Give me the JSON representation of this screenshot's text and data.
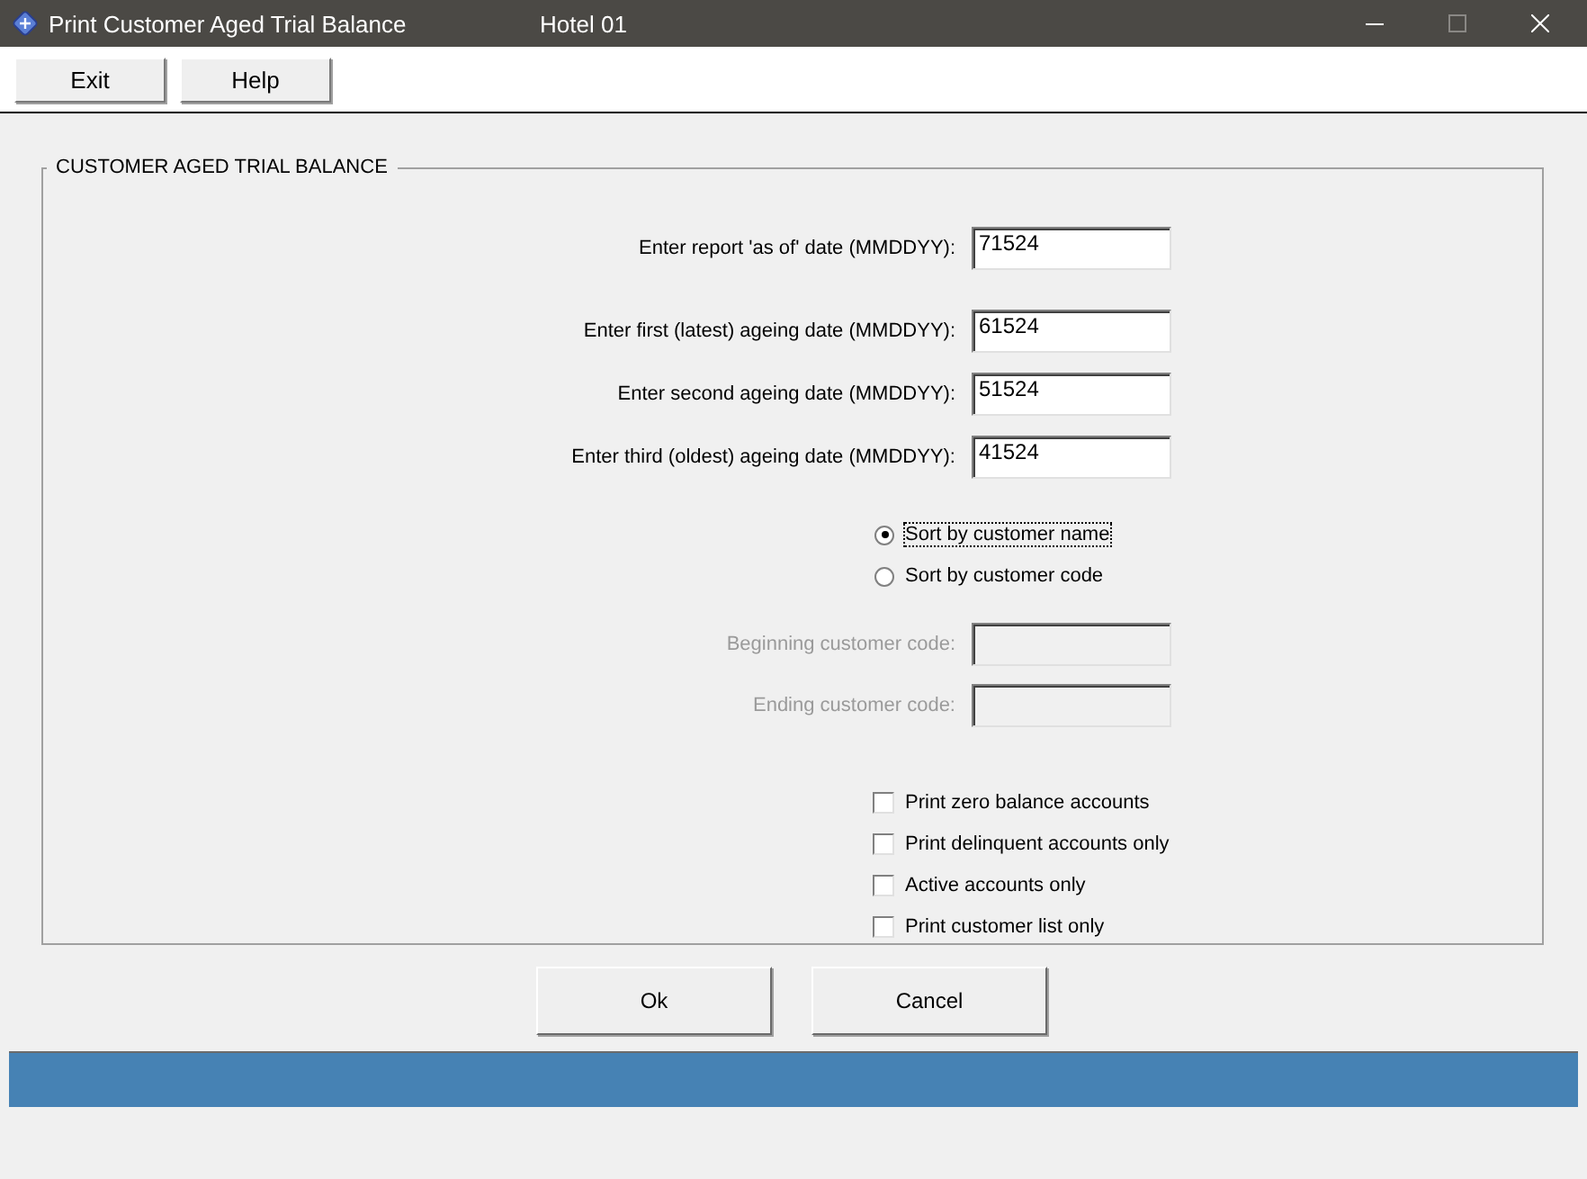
{
  "window": {
    "title": "Print Customer Aged Trial Balance",
    "subtitle": "Hotel 01"
  },
  "toolbar": [
    "Exit",
    "Help"
  ],
  "group": {
    "title": "CUSTOMER AGED TRIAL BALANCE"
  },
  "date_fields": [
    {
      "label": "Enter report 'as of' date (MMDDYY):",
      "value": "71524"
    },
    {
      "label": "Enter first (latest) ageing date (MMDDYY):",
      "value": "61524"
    },
    {
      "label": "Enter second ageing date (MMDDYY):",
      "value": "51524"
    },
    {
      "label": "Enter third (oldest) ageing date (MMDDYY):",
      "value": "41524"
    }
  ],
  "sort_options": [
    {
      "label": "Sort by customer name",
      "selected": true
    },
    {
      "label": "Sort by customer code",
      "selected": false
    }
  ],
  "code_fields": [
    {
      "label": "Beginning customer code:",
      "disabled": true
    },
    {
      "label": "Ending customer code:",
      "disabled": true
    }
  ],
  "options": [
    {
      "label": "Print zero balance accounts",
      "checked": false
    },
    {
      "label": "Print delinquent accounts only",
      "checked": false
    },
    {
      "label": "Active accounts only",
      "checked": false
    },
    {
      "label": "Print customer list only",
      "checked": false
    }
  ],
  "buttons": [
    "Ok",
    "Cancel"
  ],
  "status_bar": {
    "kind": "progress"
  }
}
